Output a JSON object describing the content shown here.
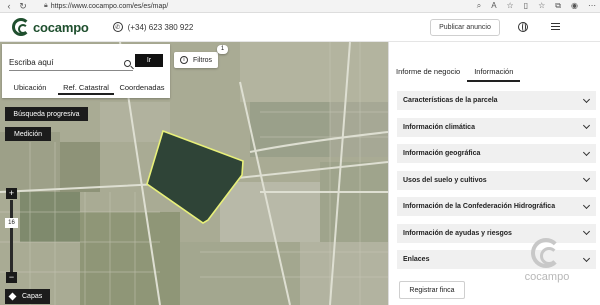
{
  "browser": {
    "url": "https://www.cocampo.com/es/es/map/",
    "icons": [
      "back-icon",
      "refresh-icon",
      "lock-icon",
      "zoom-icon",
      "read-aloud-icon",
      "favorite-icon",
      "split-icon",
      "collections-icon",
      "extensions-icon",
      "profile-icon",
      "more-icon"
    ]
  },
  "header": {
    "logo_text": "cocampo",
    "phone": "(+34) 623 380 922",
    "publish_label": "Publicar anuncio"
  },
  "search": {
    "placeholder": "Escriba aquí",
    "go_label": "Ir",
    "tabs": [
      {
        "label": "Ubicación",
        "active": false
      },
      {
        "label": "Ref. Catastral",
        "active": true
      },
      {
        "label": "Coordenadas",
        "active": false
      }
    ]
  },
  "map": {
    "filters_label": "Filtros",
    "filters_count": "1",
    "progressive_label": "Búsqueda progresiva",
    "measure_label": "Medición",
    "zoom_in": "+",
    "zoom_out": "−",
    "zoom_level": "16",
    "layers_label": "Capas",
    "colors": {
      "parcel_fill": "#2f4437",
      "parcel_outline": "#e8f07a"
    }
  },
  "panel": {
    "tabs": [
      {
        "label": "Informe de negocio",
        "active": false
      },
      {
        "label": "Información",
        "active": true
      }
    ],
    "sections": [
      "Características de la parcela",
      "Información climática",
      "Información geográfica",
      "Usos del suelo y cultivos",
      "Información de la Confederación Hidrográfica",
      "Información de ayudas y riesgos",
      "Enlaces"
    ],
    "register_label": "Registrar finca",
    "watermark_text": "cocampo"
  }
}
